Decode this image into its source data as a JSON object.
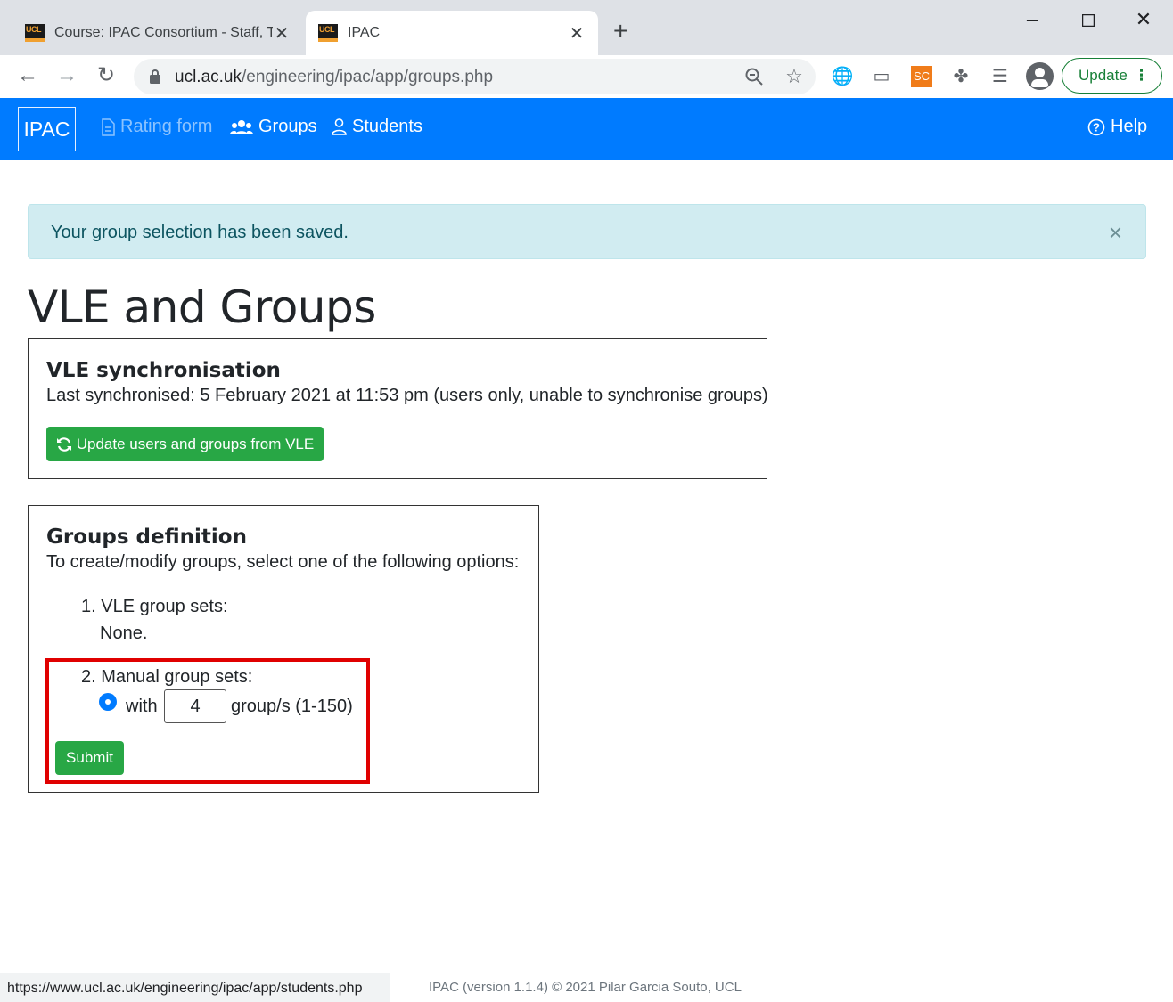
{
  "browser": {
    "tabs": [
      {
        "title": "Course: IPAC Consortium - Staff, T",
        "favicon": "UCL",
        "active": false
      },
      {
        "title": "IPAC",
        "favicon": "UCL",
        "active": true
      }
    ],
    "url_host": "ucl.ac.uk",
    "url_path": "/engineering/ipac/app/groups.php",
    "extension_sc": "SC",
    "update_label": "Update",
    "status_url": "https://www.ucl.ac.uk/engineering/ipac/app/students.php"
  },
  "navbar": {
    "brand": "IPAC",
    "items": [
      {
        "label": "Rating form",
        "icon": "file-icon",
        "disabled": true
      },
      {
        "label": "Groups",
        "icon": "users-icon",
        "disabled": false
      },
      {
        "label": "Students",
        "icon": "user-icon",
        "disabled": false
      }
    ],
    "help": "Help",
    "color": "#007bff"
  },
  "alert": {
    "message": "Your group selection has been saved.",
    "close": "×"
  },
  "page_title": "VLE and Groups",
  "vle_sync": {
    "heading": "VLE synchronisation",
    "last_sync": "Last synchronised: 5 February 2021 at 11:53 pm (users only, unable to synchronise groups)",
    "button": "Update users and groups from VLE"
  },
  "groups_definition": {
    "heading": "Groups definition",
    "intro": "To create/modify groups, select one of the following options:",
    "option1_label": "1. VLE group sets:",
    "option1_value": "None.",
    "option2_label": "2. Manual group sets:",
    "with_label": "with",
    "group_count": "4",
    "range_label": "group/s (1-150)",
    "submit": "Submit"
  },
  "footer": "IPAC (version 1.1.4) © 2021 Pilar Garcia Souto, UCL"
}
